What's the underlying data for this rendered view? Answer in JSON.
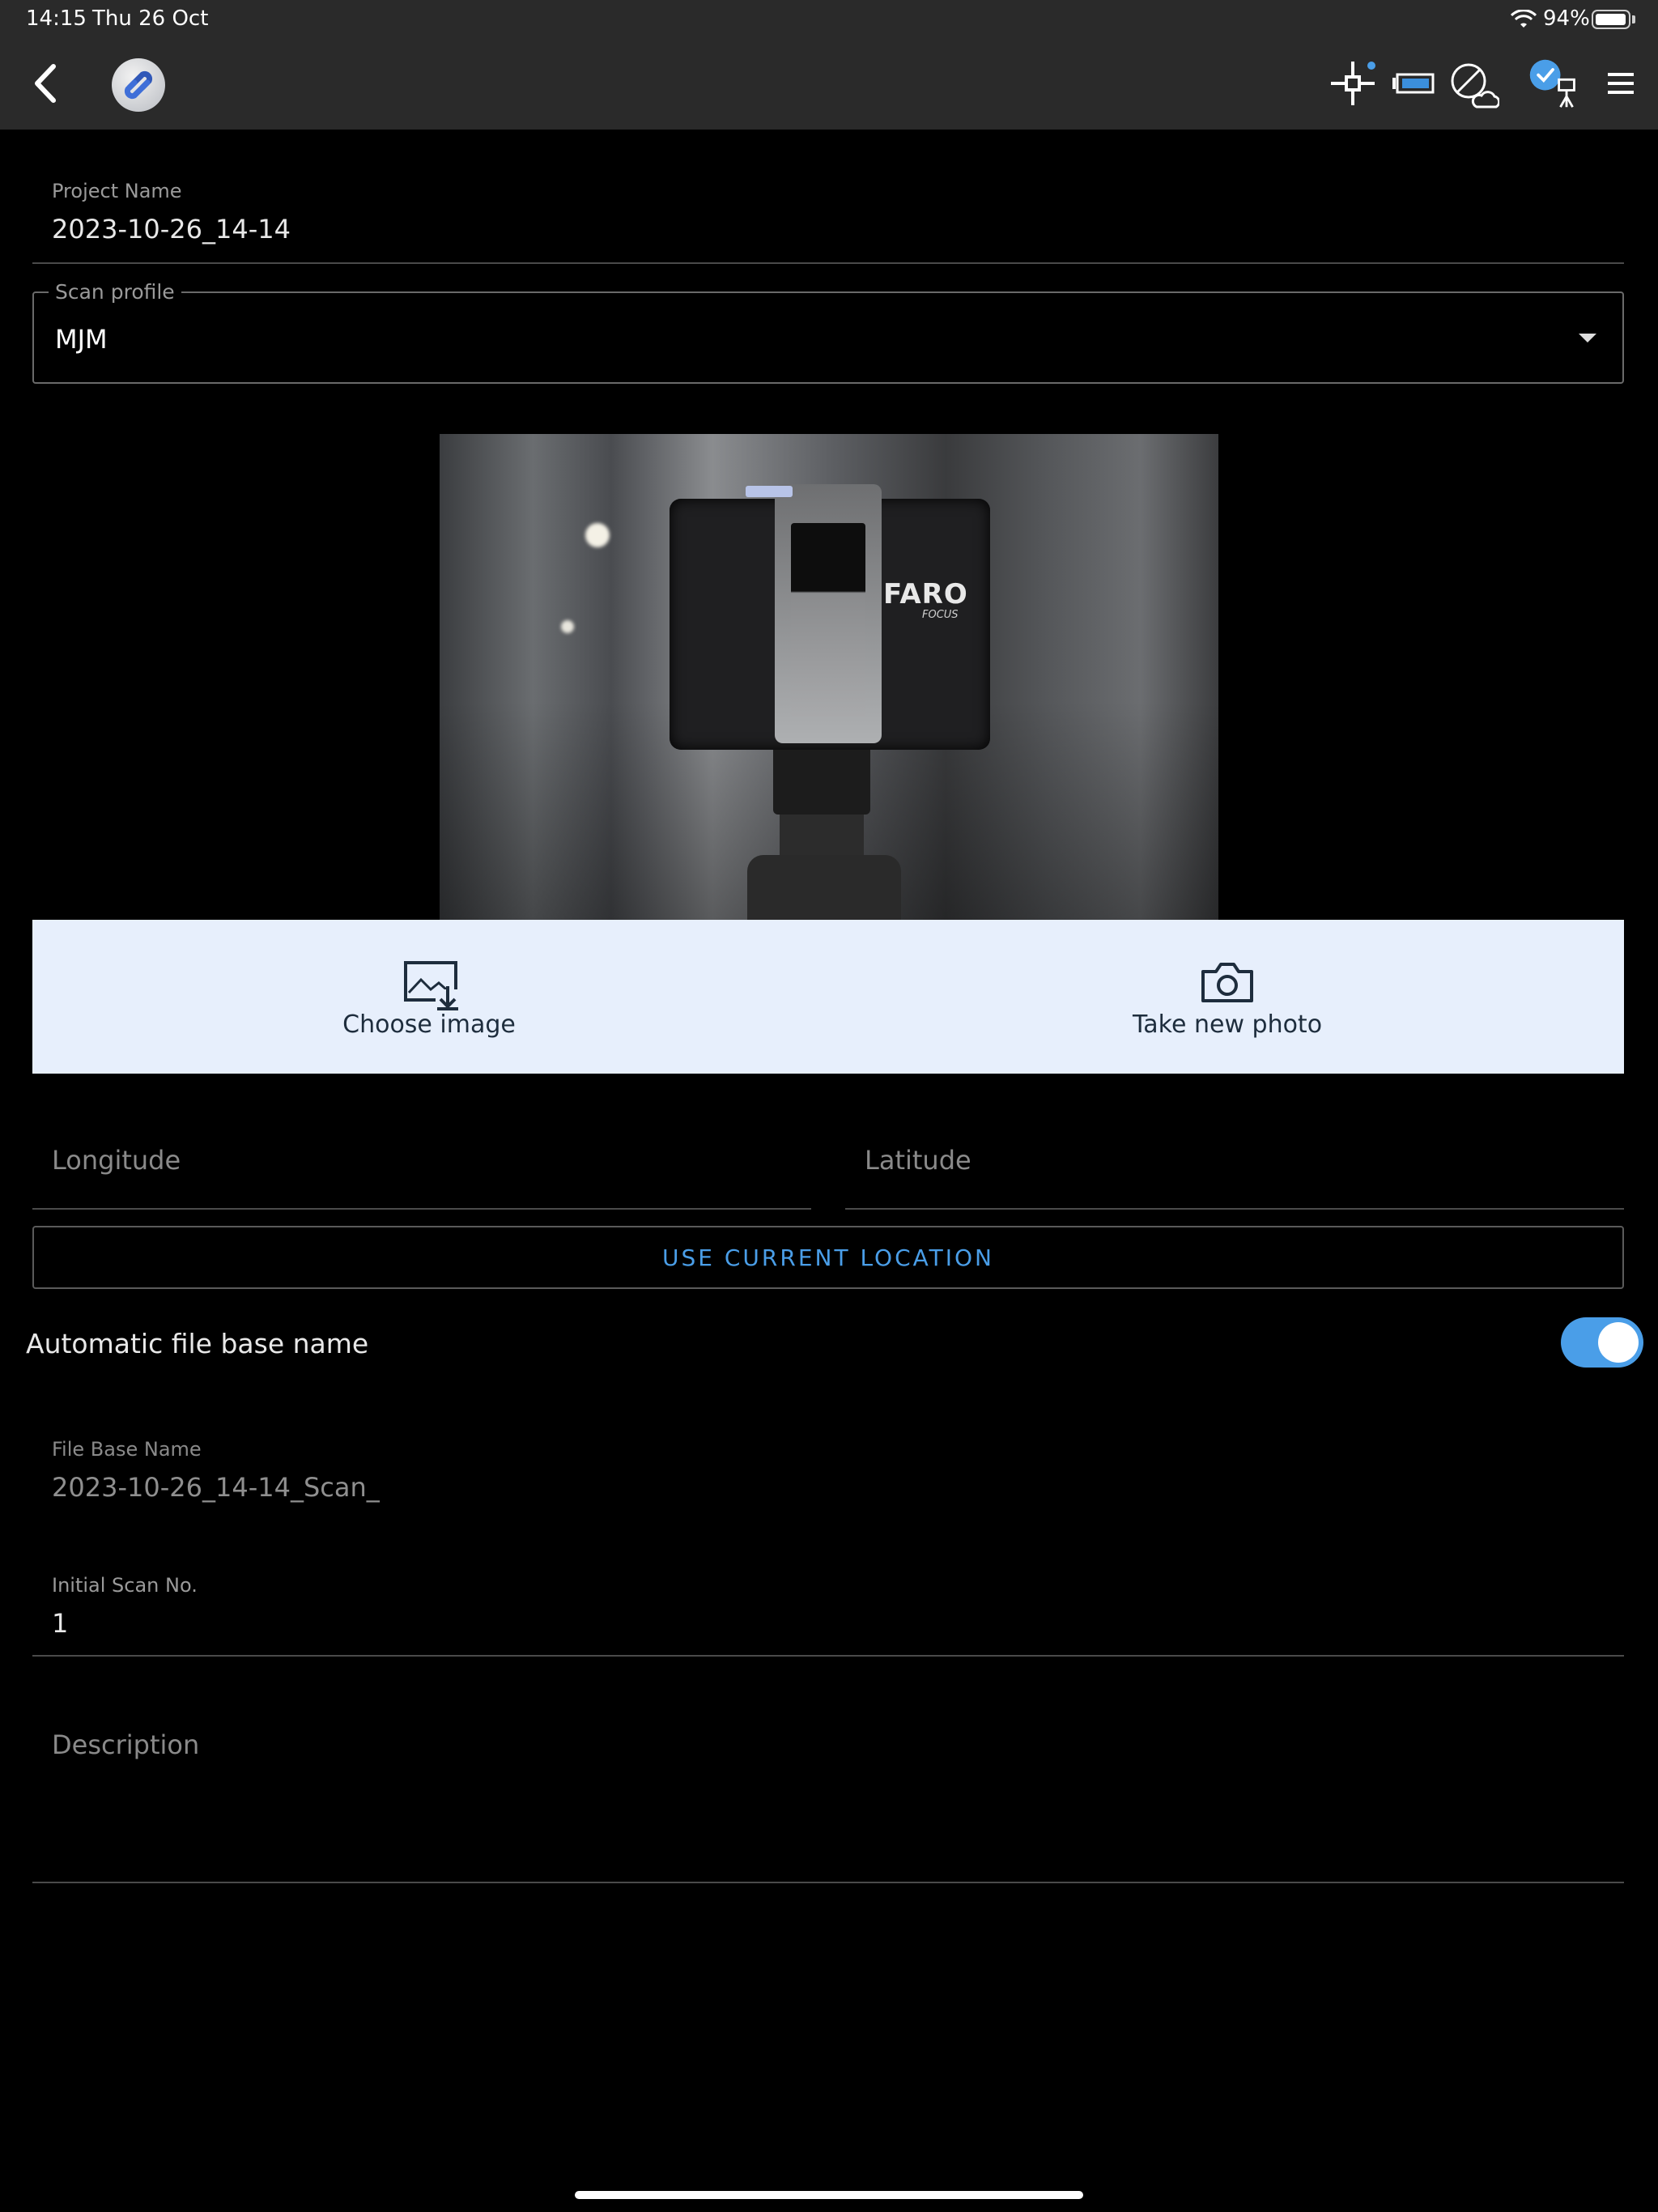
{
  "status_bar": {
    "time": "14:15",
    "date": "Thu 26 Oct",
    "battery": "94%",
    "battery_level": 0.94
  },
  "header": {
    "icons": [
      "back-chevron-icon",
      "app-logo",
      "crosshair-target-icon",
      "battery-scanner-icon",
      "cloud-offline-icon",
      "scanner-connected-icon",
      "hamburger-menu-icon"
    ],
    "accent_color": "#4a9ee8"
  },
  "form": {
    "project_name_label": "Project Name",
    "project_name_value": "2023-10-26_14-14",
    "scan_profile_label": "Scan profile",
    "scan_profile_value": "MJM",
    "image_actions": {
      "choose_label": "Choose image",
      "take_label": "Take new photo"
    },
    "longitude_placeholder": "Longitude",
    "latitude_placeholder": "Latitude",
    "use_location_label": "USE CURRENT LOCATION",
    "auto_name_label": "Automatic file base name",
    "auto_name_enabled": true,
    "file_base_label": "File Base Name",
    "file_base_value": "2023-10-26_14-14_Scan_",
    "initial_scan_label": "Initial Scan No.",
    "initial_scan_value": "1",
    "description_placeholder": "Description"
  },
  "photo": {
    "brand_text": "FARO",
    "model_text": "FOCUS"
  }
}
